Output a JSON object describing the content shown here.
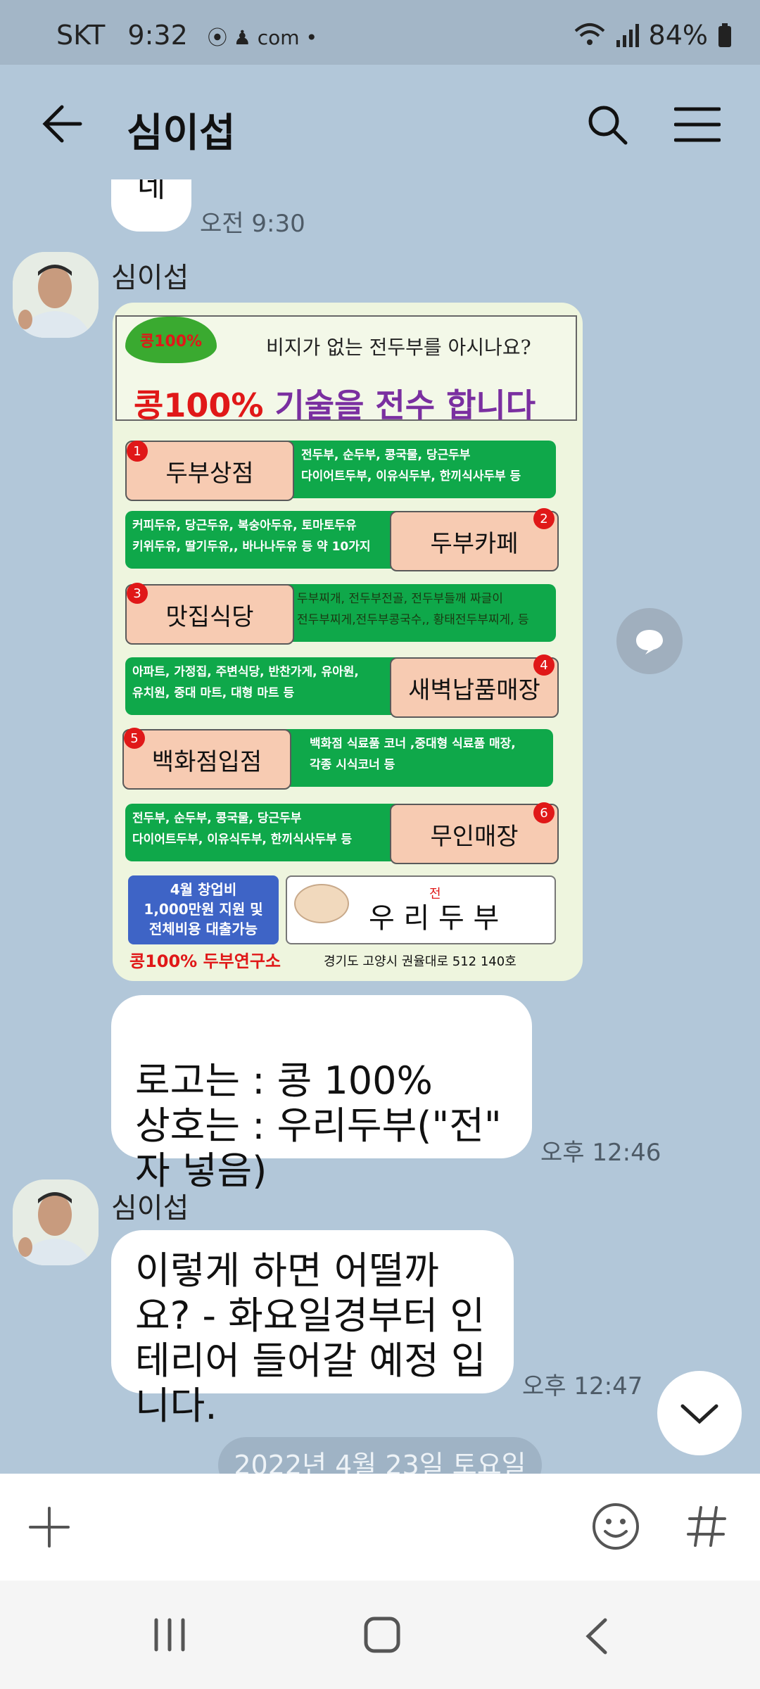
{
  "status_bar": {
    "carrier": "SKT",
    "time": "9:32",
    "indicators": "⦿ ♟ com •",
    "battery": "84%"
  },
  "header": {
    "title": "심이섭"
  },
  "messages": [
    {
      "partial_text": "네",
      "time": "오전 9:30"
    },
    {
      "sender": "심이섭"
    },
    {
      "text": "로고는 : 콩 100%\n상호는 : 우리두부(\"전\" 자 넣음)",
      "time": "오후 12:46"
    },
    {
      "sender": "심이섭",
      "text": "이렇게 하면 어떨까요? - 화요일경부터 인테리어 들어갈 예정 입니다.",
      "time": "오후 12:47"
    }
  ],
  "date_divider": "2022년 4월 23일 토요일",
  "poster": {
    "logo": "콩100%",
    "tagline": "비지가 없는 전두부를 아시나요?",
    "headline_red": "콩100%",
    "headline_purple": " 기술을 전수 합니다",
    "rows": [
      {
        "num": "1",
        "title": "두부상점",
        "desc": "전두부, 순두부, 콩국물, 당근두부\n다이어트두부, 이유식두부, 한끼식사두부 등"
      },
      {
        "num": "2",
        "title": "두부카페",
        "desc": "커피두유, 당근두유, 복숭아두유, 토마토두유\n키위두유, 딸기두유,, 바나나두유 등 약 10가지"
      },
      {
        "num": "3",
        "title": "맛집식당",
        "desc": "두부찌개, 전두부전골, 전두부들깨 짜글이\n전두부찌게,전두부콩국수,, 황태전두부찌게, 등"
      },
      {
        "num": "4",
        "title": "새벽납품매장",
        "desc": "아파트, 가정집, 주변식당, 반찬가게, 유아원,\n유치원, 중대 마트, 대형 마트 등"
      },
      {
        "num": "5",
        "title": "백화점입점",
        "desc": "백화점 식료품 코너 ,중대형 식료품 매장,\n각종 시식코너 등"
      },
      {
        "num": "6",
        "title": "무인매장",
        "desc": "전두부, 순두부, 콩국물, 당근두부\n다이어트두부, 이유식두부, 한끼식사두부 등"
      }
    ],
    "promo": "4월 창업비\n1,000만원 지원 및\n전체비용 대출가능",
    "brand": "우 리 두 부",
    "brand_mark": "전",
    "institute": "콩100% 두부연구소",
    "address": "경기도 고양시 권율대로 512 140호"
  },
  "colors": {
    "background": "#b2c7d9",
    "bubble": "#ffffff",
    "green": "#0fa84a",
    "peach": "#f7cbb2",
    "red": "#e01818",
    "purple": "#7a2fa0"
  }
}
